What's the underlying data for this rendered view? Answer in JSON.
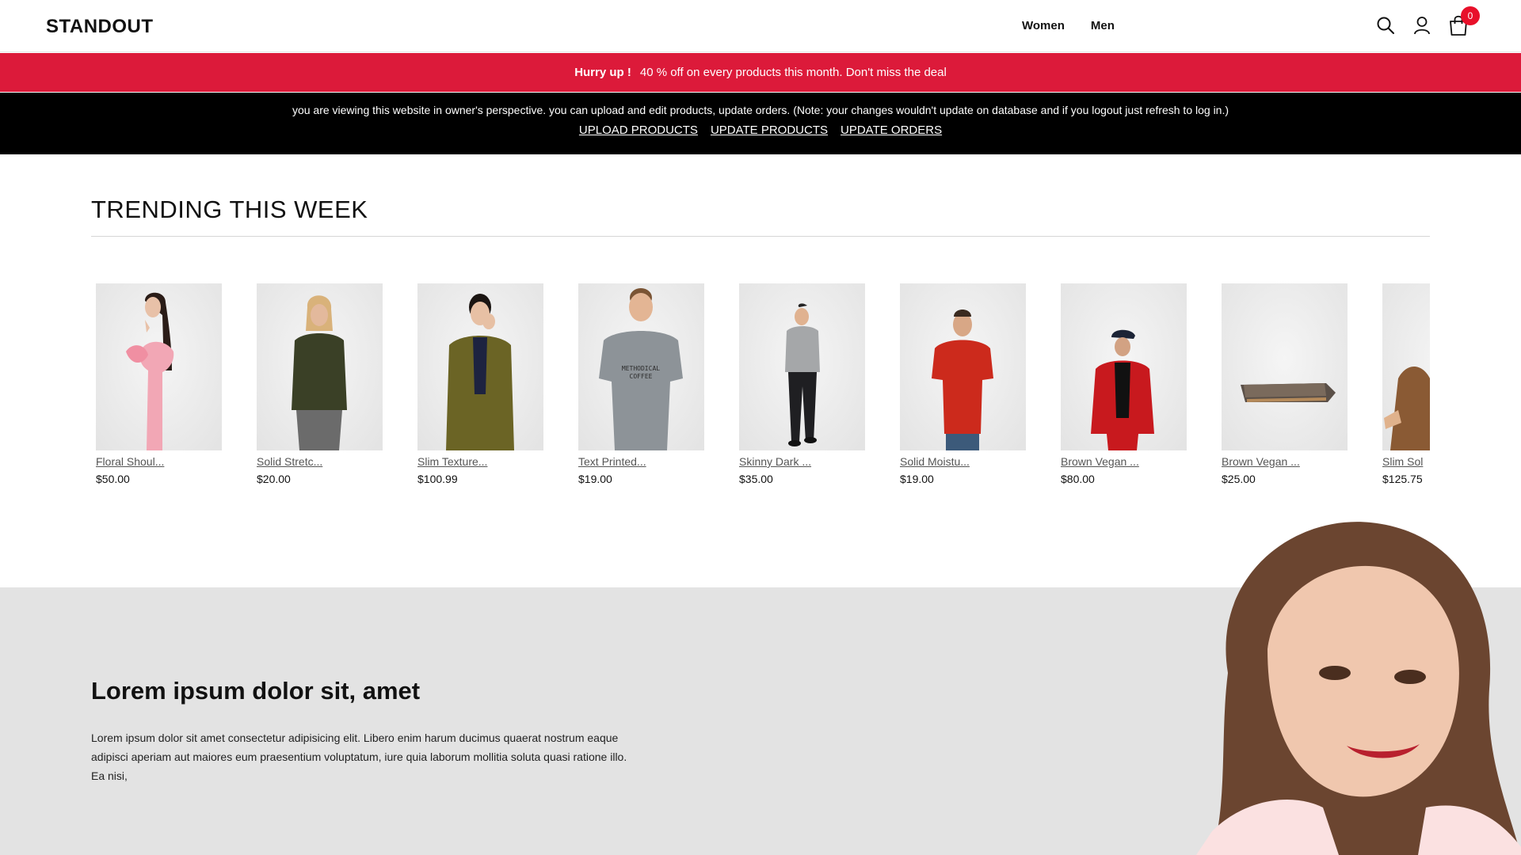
{
  "header": {
    "logo": "STANDOUT",
    "nav": [
      "Women",
      "Men"
    ],
    "cart_count": "0",
    "icons": [
      "search-icon",
      "user-icon",
      "cart-icon"
    ]
  },
  "promo": {
    "bold": "Hurry up !",
    "text": "40 % off on every products this month. Don't miss the deal",
    "color": "#dc1a3a"
  },
  "owner_bar": {
    "note": "you are viewing this website in owner's perspective. you can upload and edit products, update orders. (Note: your changes wouldn't update on database and if you logout just refresh to log in.)",
    "links": [
      "UPLOAD PRODUCTS",
      "UPDATE PRODUCTS",
      "UPDATE ORDERS"
    ]
  },
  "trending": {
    "title": "TRENDING THIS WEEK",
    "products": [
      {
        "name": "Floral Shoul...",
        "price": "$50.00"
      },
      {
        "name": "Solid Stretc...",
        "price": "$20.00"
      },
      {
        "name": "Slim Texture...",
        "price": "$100.99"
      },
      {
        "name": "Text Printed...",
        "price": "$19.00"
      },
      {
        "name": "Skinny Dark ...",
        "price": "$35.00"
      },
      {
        "name": "Solid Moistu...",
        "price": "$19.00"
      },
      {
        "name": "Brown Vegan ...",
        "price": "$80.00"
      },
      {
        "name": "Brown Vegan ...",
        "price": "$25.00"
      },
      {
        "name": "Slim Sol",
        "price": "$125.75"
      }
    ]
  },
  "hero": {
    "title": "Lorem ipsum dolor sit, amet",
    "text": "Lorem ipsum dolor sit amet consectetur adipisicing elit. Libero enim harum ducimus quaerat nostrum eaque adipisci aperiam aut maiores eum praesentium voluptatum, iure quia laborum mollitia soluta quasi ratione illo. Ea nisi,"
  }
}
